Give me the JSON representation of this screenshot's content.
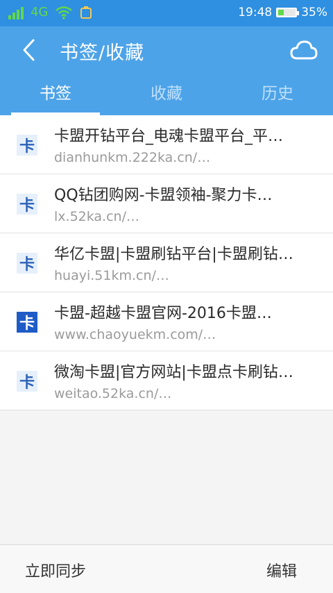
{
  "status_bar": {
    "network": "4G",
    "time": "19:48",
    "battery": "35%",
    "battery_level": 0.35,
    "accent_color": "#63d84a"
  },
  "header": {
    "title": "书签/收藏",
    "back_icon": "chevron-left-icon",
    "cloud_icon": "cloud-sync-icon",
    "bg_color": "#4da3e8"
  },
  "tabs": [
    {
      "label": "书签",
      "active": true
    },
    {
      "label": "收藏",
      "active": false
    },
    {
      "label": "历史",
      "active": false
    }
  ],
  "bookmarks": [
    {
      "title": "卡盟开钻平台_电魂卡盟平台_平…",
      "url": "dianhunkm.222ka.cn/…",
      "icon": "ka-favicon-light"
    },
    {
      "title": "QQ钻团购网-卡盟领袖-聚力卡…",
      "url": "lx.52ka.cn/…",
      "icon": "ka-favicon-light"
    },
    {
      "title": "华亿卡盟|卡盟刷钻平台|卡盟刷钻…",
      "url": "huayi.51km.cn/…",
      "icon": "ka-favicon-light"
    },
    {
      "title": "卡盟-超越卡盟官网-2016卡盟…",
      "url": "www.chaoyuekm.com/…",
      "icon": "ka-favicon-dark"
    },
    {
      "title": "微淘卡盟|官方网站|卡盟点卡刷钻…",
      "url": "weitao.52ka.cn/…",
      "icon": "ka-favicon-light"
    }
  ],
  "bottom_bar": {
    "sync_label": "立即同步",
    "edit_label": "编辑"
  }
}
